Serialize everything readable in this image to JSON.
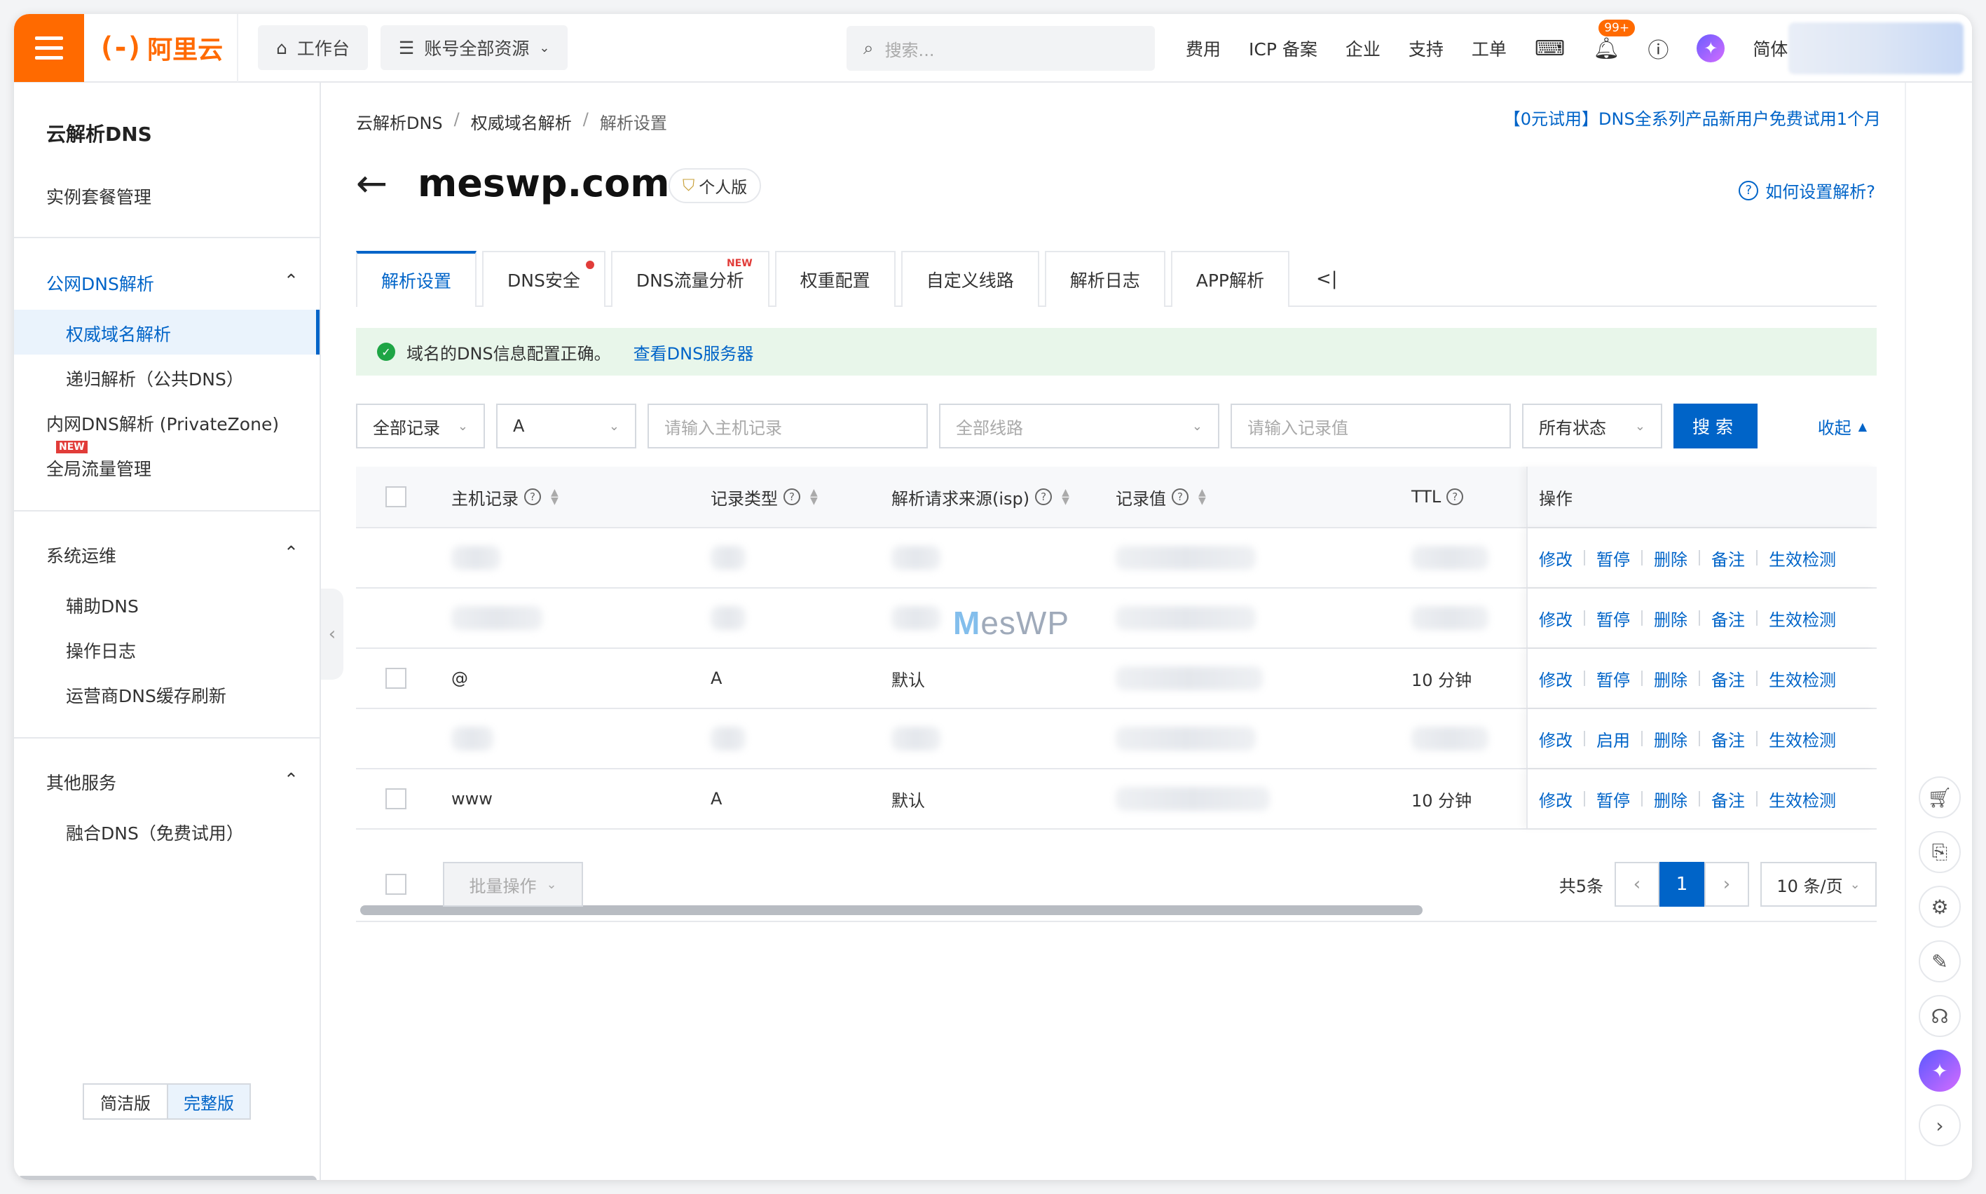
{
  "topbar": {
    "logo_mark": "(-)",
    "logo_text": "阿里云",
    "workbench": "工作台",
    "account_resources": "账号全部资源",
    "search_placeholder": "搜索...",
    "links": [
      "费用",
      "ICP 备案",
      "企业",
      "支持",
      "工单"
    ],
    "notification_count": "99+",
    "language": "简体"
  },
  "sidebar": {
    "title": "云解析DNS",
    "instance_mgmt": "实例套餐管理",
    "public_dns": "公网DNS解析",
    "authoritative": "权威域名解析",
    "recursive": "递归解析（公共DNS）",
    "private_zone": "内网DNS解析 (PrivateZone)",
    "new_tag": "NEW",
    "global_traffic": "全局流量管理",
    "ops_group": "系统运维",
    "ops_items": [
      "辅助DNS",
      "操作日志",
      "运营商DNS缓存刷新"
    ],
    "other_group": "其他服务",
    "other_items": [
      "融合DNS（免费试用）"
    ],
    "version_simple": "简洁版",
    "version_full": "完整版"
  },
  "breadcrumb": [
    "云解析DNS",
    "权威域名解析",
    "解析设置"
  ],
  "promo": "【0元试用】DNS全系列产品新用户免费试用1个月",
  "domain": "meswp.com",
  "edition": "个人版",
  "help_link": "如何设置解析?",
  "tabs": [
    "解析设置",
    "DNS安全",
    "DNS流量分析",
    "权重配置",
    "自定义线路",
    "解析日志",
    "APP解析"
  ],
  "tab_new": "NEW",
  "alert": {
    "message": "域名的DNS信息配置正确。",
    "link": "查看DNS服务器"
  },
  "filters": {
    "record_scope": "全部记录",
    "record_type": "A",
    "host_placeholder": "请输入主机记录",
    "line": "全部线路",
    "value_placeholder": "请输入记录值",
    "status": "所有状态",
    "search": "搜索",
    "collapse": "收起"
  },
  "table": {
    "headers": {
      "host": "主机记录",
      "type": "记录类型",
      "isp": "解析请求来源(isp)",
      "value": "记录值",
      "ttl": "TTL",
      "ops": "操作"
    },
    "rows": [
      {
        "host": "",
        "type": "",
        "isp": "",
        "ttl": "",
        "ops": [
          "修改",
          "暂停",
          "删除",
          "备注",
          "生效检测"
        ]
      },
      {
        "host": "",
        "type": "",
        "isp": "",
        "ttl": "",
        "ops": [
          "修改",
          "暂停",
          "删除",
          "备注",
          "生效检测"
        ]
      },
      {
        "host": "@",
        "type": "A",
        "isp": "默认",
        "ttl": "10 分钟",
        "ops": [
          "修改",
          "暂停",
          "删除",
          "备注",
          "生效检测"
        ]
      },
      {
        "host": "",
        "type": "",
        "isp": "",
        "ttl": "",
        "ops": [
          "修改",
          "启用",
          "删除",
          "备注",
          "生效检测"
        ]
      },
      {
        "host": "www",
        "type": "A",
        "isp": "默认",
        "ttl": "10 分钟",
        "ops": [
          "修改",
          "暂停",
          "删除",
          "备注",
          "生效检测"
        ]
      }
    ]
  },
  "footer": {
    "batch": "批量操作",
    "total": "共5条",
    "current_page": "1",
    "page_size": "10 条/页"
  },
  "watermark": {
    "m": "M",
    "rest": "esWP"
  },
  "colors": {
    "brand": "#ff6a00",
    "primary": "#0064c8",
    "success": "#1ea545",
    "danger": "#e13c39"
  }
}
